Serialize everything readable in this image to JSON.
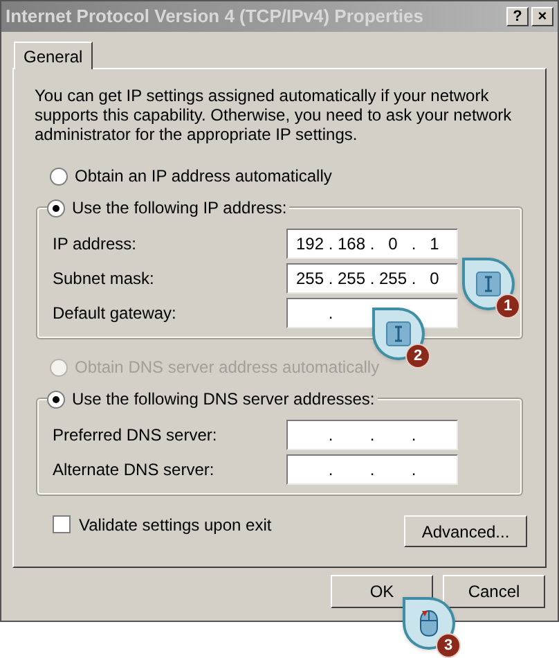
{
  "window": {
    "title": "Internet Protocol Version 4 (TCP/IPv4) Properties",
    "buttons": [
      "?",
      "×"
    ]
  },
  "tabs": [
    {
      "label": "General",
      "selected": true
    }
  ],
  "intro": "You can get IP settings assigned automatically if your network supports this capability. Otherwise, you need to ask your network administrator for the appropriate IP settings.",
  "ip_mode": [
    {
      "label": "Obtain an IP address automatically",
      "selected": false,
      "disabled": false
    },
    {
      "label": "Use the following IP address:",
      "selected": true,
      "disabled": false
    }
  ],
  "ip_fields": [
    {
      "label": "IP address:",
      "octets": [
        "192",
        "168",
        "0",
        "1"
      ],
      "dots": [
        ".",
        ".",
        "."
      ]
    },
    {
      "label": "Subnet mask:",
      "octets": [
        "255",
        "255",
        "255",
        "0"
      ],
      "dots": [
        ".",
        ".",
        "."
      ]
    },
    {
      "label": "Default gateway:",
      "dots": [
        "."
      ]
    }
  ],
  "dns_mode": [
    {
      "label": "Obtain DNS server address automatically",
      "selected": false,
      "disabled": true
    },
    {
      "label": "Use the following DNS server addresses:",
      "selected": true,
      "disabled": false
    }
  ],
  "dns_fields": [
    {
      "label": "Preferred DNS server:",
      "dots": [
        ".",
        ".",
        "."
      ]
    },
    {
      "label": "Alternate DNS server:",
      "dots": [
        ".",
        ".",
        "."
      ]
    }
  ],
  "validate": {
    "label": "Validate settings upon exit",
    "checked": false
  },
  "advanced_button": "Advanced...",
  "buttons": [
    "OK",
    "Cancel"
  ],
  "callouts": [
    {
      "kind": "keyboard",
      "number": "1"
    },
    {
      "kind": "keyboard",
      "number": "2"
    },
    {
      "kind": "mouse",
      "number": "3"
    }
  ]
}
